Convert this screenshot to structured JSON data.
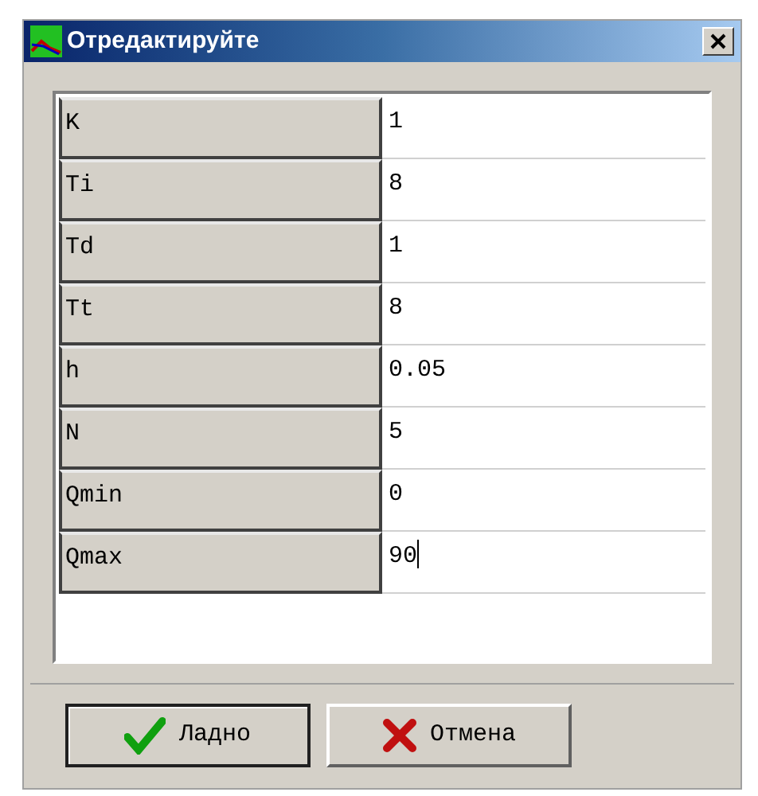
{
  "window": {
    "title": "Отредактируйте"
  },
  "rows": [
    {
      "name": "K",
      "value": "1",
      "editing": false
    },
    {
      "name": "Ti",
      "value": "8",
      "editing": false
    },
    {
      "name": "Td",
      "value": "1",
      "editing": false
    },
    {
      "name": "Tt",
      "value": "8",
      "editing": false
    },
    {
      "name": "h",
      "value": "0.05",
      "editing": false
    },
    {
      "name": "N",
      "value": "5",
      "editing": false
    },
    {
      "name": "Qmin",
      "value": "0",
      "editing": false
    },
    {
      "name": "Qmax",
      "value": "90",
      "editing": true
    }
  ],
  "buttons": [
    {
      "kind": "ok",
      "label": "Ладно",
      "default": true
    },
    {
      "kind": "cancel",
      "label": "Отмена",
      "default": false
    }
  ]
}
